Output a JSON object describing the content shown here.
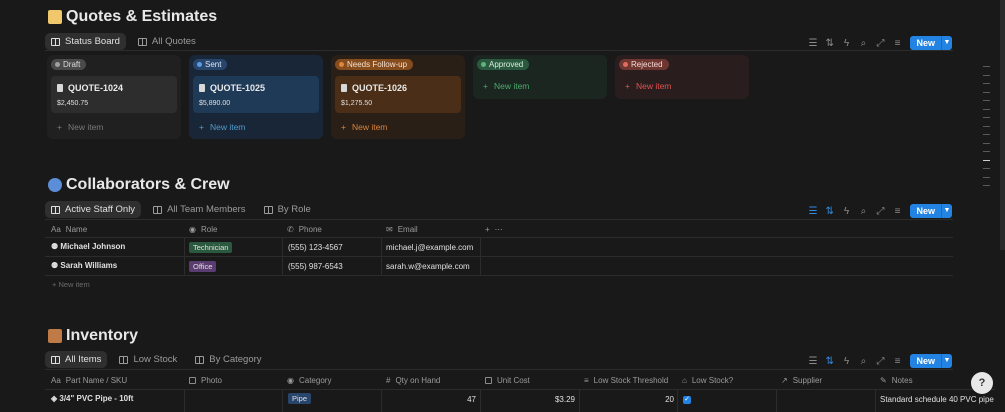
{
  "quotes": {
    "title": "Quotes & Estimates",
    "views": [
      "Status Board",
      "All Quotes"
    ],
    "new_label": "New",
    "columns": [
      {
        "label": "Draft",
        "card_title": "QUOTE-1024",
        "card_value": "$2,450.75",
        "new_item": "New item",
        "bg": "#202020",
        "card_bg": "#2d2d2d",
        "pill_bg": "#4a4a4a",
        "pill_dot": "#a0a0a0",
        "text": "#9b9b9b"
      },
      {
        "label": "Sent",
        "card_title": "QUOTE-1025",
        "card_value": "$5,890.00",
        "new_item": "New item",
        "bg": "#182638",
        "card_bg": "#1f3a57",
        "pill_bg": "#28456c",
        "pill_dot": "#5c9ce6",
        "text": "#529cca"
      },
      {
        "label": "Needs Follow-up",
        "card_title": "QUOTE-1026",
        "card_value": "$1,275.50",
        "new_item": "New item",
        "bg": "#2a1f17",
        "card_bg": "#4a2e17",
        "pill_bg": "#854c1d",
        "pill_dot": "#e0863a",
        "text": "#d9843b"
      },
      {
        "label": "Approved",
        "new_item": "New item",
        "bg": "#1b2620",
        "pill_bg": "#2b593f",
        "pill_dot": "#5fb47a",
        "text": "#4dab6f"
      },
      {
        "label": "Rejected",
        "new_item": "New item",
        "bg": "#2a1d1d",
        "pill_bg": "#6e3630",
        "pill_dot": "#e06b5f",
        "text": "#df5452"
      }
    ]
  },
  "crew": {
    "title": "Collaborators & Crew",
    "views": [
      "Active Staff Only",
      "All Team Members",
      "By Role"
    ],
    "new_label": "New",
    "headers": [
      "Name",
      "Role",
      "Phone",
      "Email"
    ],
    "rows": [
      {
        "name": "Michael Johnson",
        "role": "Technician",
        "role_bg": "#2b593f",
        "phone": "(555) 123-4567",
        "email": "michael.j@example.com"
      },
      {
        "name": "Sarah Williams",
        "role": "Office",
        "role_bg": "#5a3c70",
        "phone": "(555) 987-6543",
        "email": "sarah.w@example.com"
      }
    ],
    "new_row": "New item"
  },
  "inventory": {
    "title": "Inventory",
    "views": [
      "All Items",
      "Low Stock",
      "By Category"
    ],
    "new_label": "New",
    "headers": [
      "Part Name / SKU",
      "Photo",
      "Category",
      "Qty on Hand",
      "Unit Cost",
      "Low Stock Threshold",
      "Low Stock?",
      "Supplier",
      "Notes"
    ],
    "rows": [
      {
        "name": "3/4\" PVC Pipe - 10ft",
        "category": "Pipe",
        "category_bg": "#28456c",
        "qty": "47",
        "cost": "$3.29",
        "threshold": "20",
        "low_stock": true,
        "notes": "Standard schedule 40 PVC pipe"
      }
    ]
  },
  "help_label": "?"
}
